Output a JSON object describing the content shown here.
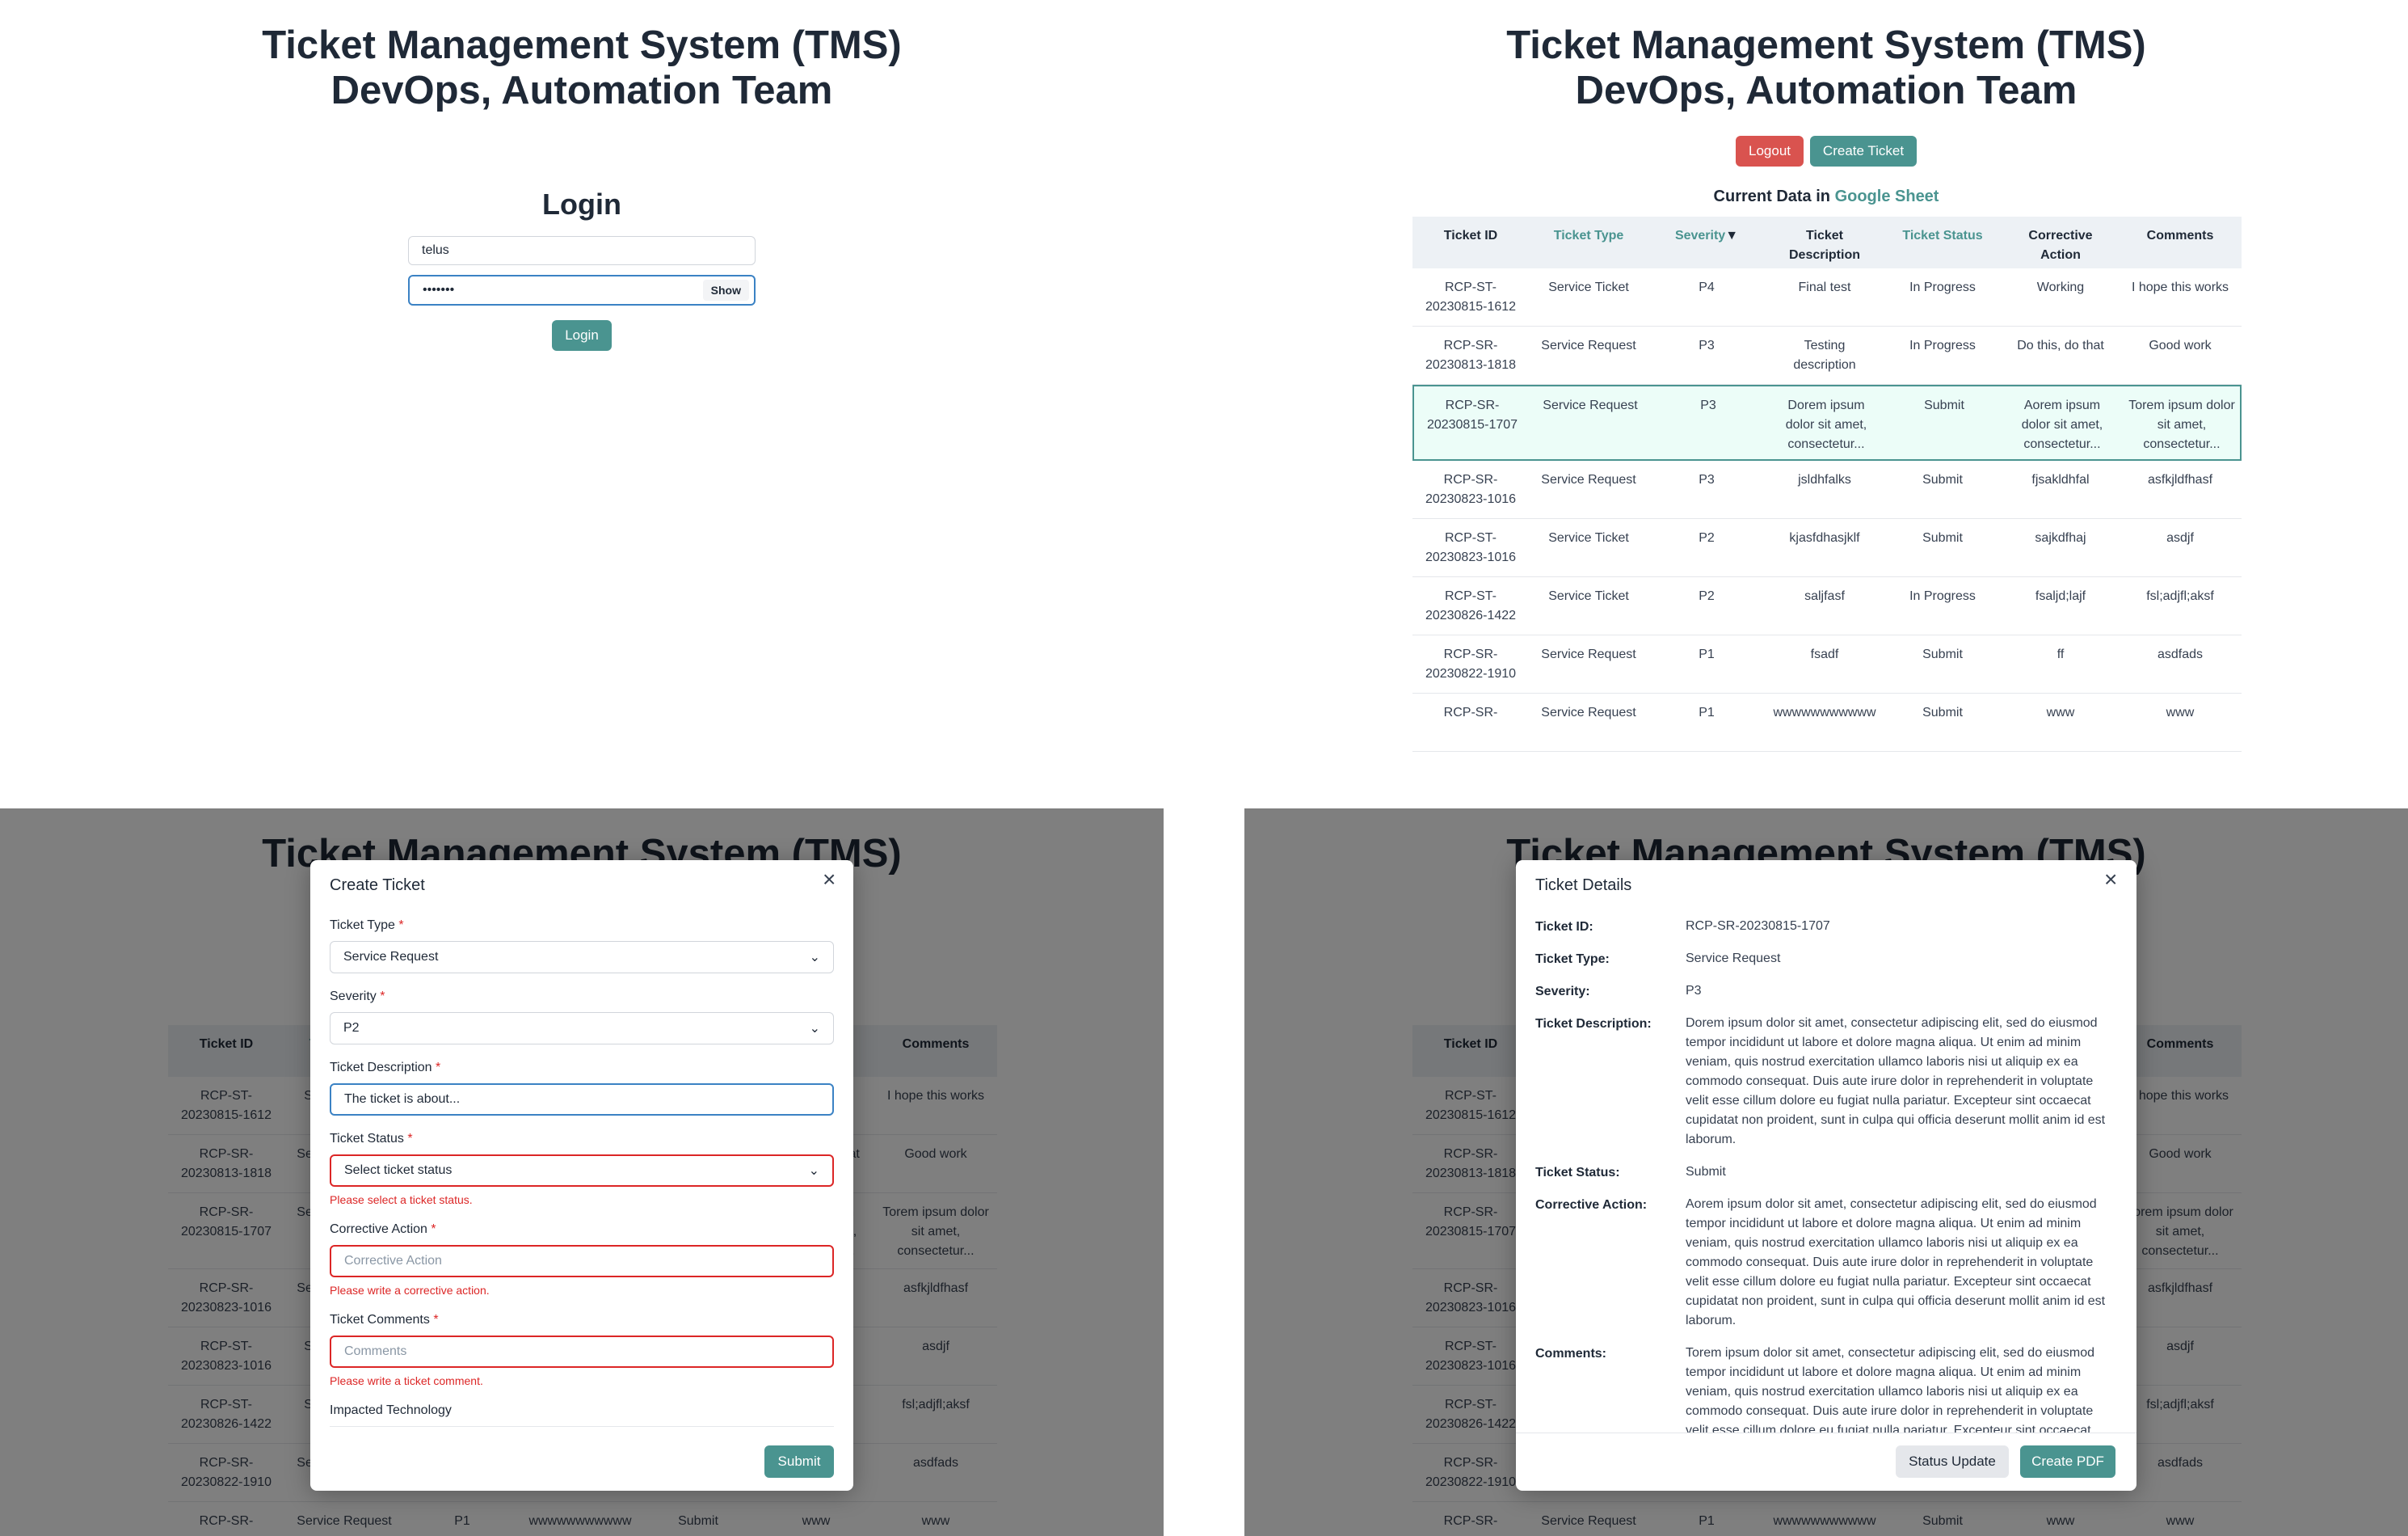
{
  "app": {
    "title_line1": "Ticket Management System (TMS)",
    "title_line2": "DevOps, Automation Team"
  },
  "login": {
    "heading": "Login",
    "username": "telus",
    "password": "•••••••",
    "show_label": "Show",
    "login_label": "Login"
  },
  "dashboard": {
    "logout_label": "Logout",
    "create_label": "Create Ticket",
    "current_data_prefix": "Current Data in",
    "sheet_link": "Google Sheet",
    "sort_arrow": "▼"
  },
  "table": {
    "headers": [
      "Ticket ID",
      "Ticket Type",
      "Severity",
      "Ticket Description",
      "Ticket Status",
      "Corrective Action",
      "Comments"
    ],
    "rows": [
      [
        "RCP-ST-20230815-1612",
        "Service Ticket",
        "P4",
        "Final test",
        "In Progress",
        "Working",
        "I hope this works"
      ],
      [
        "RCP-SR-20230813-1818",
        "Service Request",
        "P3",
        "Testing description",
        "In Progress",
        "Do this, do that",
        "Good work"
      ],
      [
        "RCP-SR-20230815-1707",
        "Service Request",
        "P3",
        "Dorem ipsum dolor sit amet, consectetur...",
        "Submit",
        "Aorem ipsum dolor sit amet, consectetur...",
        "Torem ipsum dolor sit amet, consectetur..."
      ],
      [
        "RCP-SR-20230823-1016",
        "Service Request",
        "P3",
        "jsldhfalks",
        "Submit",
        "fjsakldhfal",
        "asfkjldfhasf"
      ],
      [
        "RCP-ST-20230823-1016",
        "Service Ticket",
        "P2",
        "kjasfdhasjklf",
        "Submit",
        "sajkdfhaj",
        "asdjf"
      ],
      [
        "RCP-ST-20230826-1422",
        "Service Ticket",
        "P2",
        "saljfasf",
        "In Progress",
        "fsaljd;lajf",
        "fsl;adjfl;aksf"
      ],
      [
        "RCP-SR-20230822-1910",
        "Service Request",
        "P1",
        "fsadf",
        "Submit",
        "ff",
        "asdfads"
      ],
      [
        "RCP-SR-",
        "Service Request",
        "P1",
        "wwwwwwwwwww",
        "Submit",
        "www",
        "www"
      ]
    ]
  },
  "create_modal": {
    "title": "Create Ticket",
    "close": "×",
    "type_label": "Ticket Type",
    "type_value": "Service Request",
    "severity_label": "Severity",
    "severity_value": "P2",
    "desc_label": "Ticket Description",
    "desc_value": "The ticket is about...",
    "status_label": "Ticket Status",
    "status_value": "Select ticket status",
    "status_error": "Please select a ticket status.",
    "action_label": "Corrective Action",
    "action_placeholder": "Corrective Action",
    "action_error": "Please write a corrective action.",
    "comments_label": "Ticket Comments",
    "comments_placeholder": "Comments",
    "comments_error": "Please write a ticket comment.",
    "impacted_label": "Impacted Technology",
    "submit_label": "Submit",
    "required_mark": "*"
  },
  "details_modal": {
    "title": "Ticket Details",
    "close": "×",
    "id_label": "Ticket ID:",
    "id_value": "RCP-SR-20230815-1707",
    "type_label": "Ticket Type:",
    "type_value": "Service Request",
    "severity_label": "Severity:",
    "severity_value": "P3",
    "desc_label": "Ticket Description:",
    "desc_value": "Dorem ipsum dolor sit amet, consectetur adipiscing elit, sed do eiusmod tempor incididunt ut labore et dolore magna aliqua. Ut enim ad minim veniam, quis nostrud exercitation ullamco laboris nisi ut aliquip ex ea commodo consequat. Duis aute irure dolor in reprehenderit in voluptate velit esse cillum dolore eu fugiat nulla pariatur. Excepteur sint occaecat cupidatat non proident, sunt in culpa qui officia deserunt mollit anim id est laborum.",
    "status_label": "Ticket Status:",
    "status_value": "Submit",
    "action_label": "Corrective Action:",
    "action_value": "Aorem ipsum dolor sit amet, consectetur adipiscing elit, sed do eiusmod tempor incididunt ut labore et dolore magna aliqua. Ut enim ad minim veniam, quis nostrud exercitation ullamco laboris nisi ut aliquip ex ea commodo consequat. Duis aute irure dolor in reprehenderit in voluptate velit esse cillum dolore eu fugiat nulla pariatur. Excepteur sint occaecat cupidatat non proident, sunt in culpa qui officia deserunt mollit anim id est laborum.",
    "comments_label": "Comments:",
    "comments_value": "Torem ipsum dolor sit amet, consectetur adipiscing elit, sed do eiusmod tempor incididunt ut labore et dolore magna aliqua. Ut enim ad minim veniam, quis nostrud exercitation ullamco laboris nisi ut aliquip ex ea commodo consequat. Duis aute irure dolor in reprehenderit in voluptate velit esse cillum dolore eu fugiat nulla pariatur. Excepteur sint occaecat",
    "status_update_label": "Status Update",
    "pdf_label": "Create PDF"
  },
  "colors": {
    "accent": "#4a9490",
    "danger": "#d9534f",
    "error": "#dc2626",
    "selected_row": "#ecfdf8"
  }
}
